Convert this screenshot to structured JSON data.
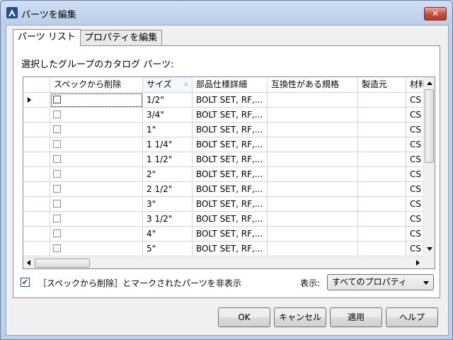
{
  "window": {
    "title": "パーツを編集",
    "close_glyph": "✕"
  },
  "tabs": [
    {
      "label": "パーツ リスト"
    },
    {
      "label": "プロパティを編集"
    }
  ],
  "panel": {
    "label": "選択したグループのカタログ パーツ:"
  },
  "grid": {
    "columns": [
      "スペックから削除",
      "サイズ",
      "部品仕様詳細",
      "互換性がある規格",
      "製造元",
      "材料"
    ],
    "sorted_column": "サイズ",
    "rows": [
      {
        "remove": false,
        "size": "1/2\"",
        "desc": "BOLT SET, RF,...",
        "compat": "",
        "maker": "",
        "material": "CS"
      },
      {
        "remove": false,
        "size": "3/4\"",
        "desc": "BOLT SET, RF,...",
        "compat": "",
        "maker": "",
        "material": "CS"
      },
      {
        "remove": false,
        "size": "1\"",
        "desc": "BOLT SET, RF,...",
        "compat": "",
        "maker": "",
        "material": "CS"
      },
      {
        "remove": false,
        "size": "1 1/4\"",
        "desc": "BOLT SET, RF,...",
        "compat": "",
        "maker": "",
        "material": "CS"
      },
      {
        "remove": false,
        "size": "1 1/2\"",
        "desc": "BOLT SET, RF,...",
        "compat": "",
        "maker": "",
        "material": "CS"
      },
      {
        "remove": false,
        "size": "2\"",
        "desc": "BOLT SET, RF,...",
        "compat": "",
        "maker": "",
        "material": "CS"
      },
      {
        "remove": false,
        "size": "2 1/2\"",
        "desc": "BOLT SET, RF,...",
        "compat": "",
        "maker": "",
        "material": "CS"
      },
      {
        "remove": false,
        "size": "3\"",
        "desc": "BOLT SET, RF,...",
        "compat": "",
        "maker": "",
        "material": "CS"
      },
      {
        "remove": false,
        "size": "3 1/2\"",
        "desc": "BOLT SET, RF,...",
        "compat": "",
        "maker": "",
        "material": "CS"
      },
      {
        "remove": false,
        "size": "4\"",
        "desc": "BOLT SET, RF,...",
        "compat": "",
        "maker": "",
        "material": "CS"
      },
      {
        "remove": false,
        "size": "5\"",
        "desc": "BOLT SET, RF,...",
        "compat": "",
        "maker": "",
        "material": "CS"
      }
    ],
    "current_row": 0
  },
  "options": {
    "hide_removed_label": "［スペックから削除］とマークされたパーツを非表示",
    "hide_removed_checked": true,
    "show_label": "表示:",
    "show_value": "すべてのプロパティ"
  },
  "buttons": {
    "ok": "OK",
    "cancel": "キャンセル",
    "apply": "適用",
    "help": "ヘルプ"
  },
  "icons": {
    "app": "autocad-plant-a-icon",
    "close": "close-icon"
  },
  "colors": {
    "title_bg": "#c9d9ee",
    "close_red": "#c9503d",
    "checkbox_blue": "#1c5180"
  }
}
